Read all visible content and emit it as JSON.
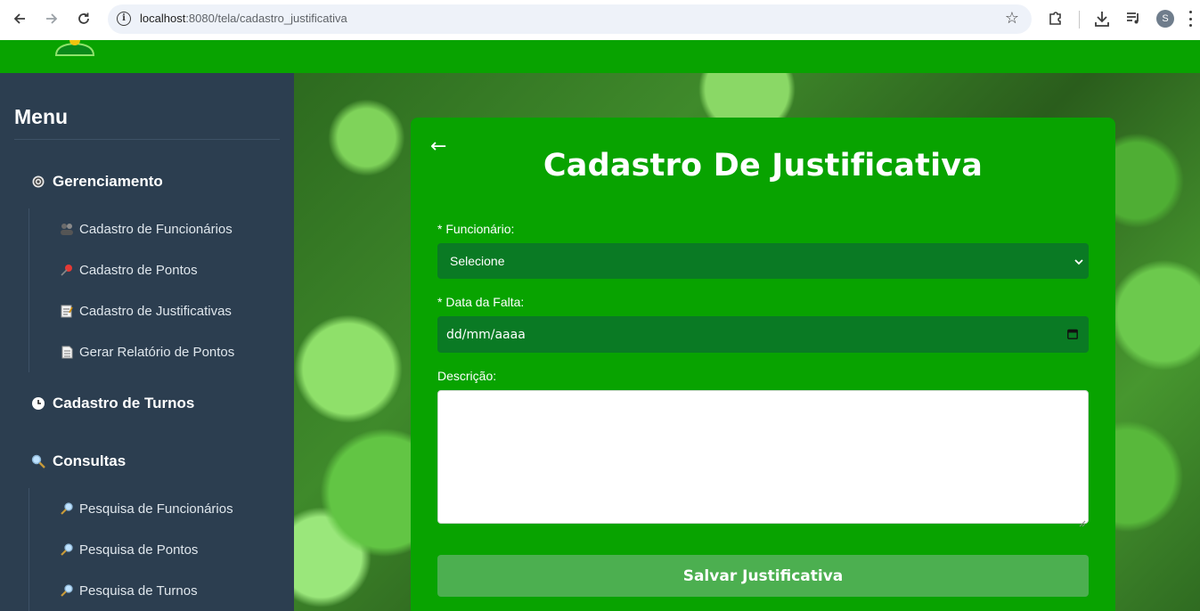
{
  "browser": {
    "url_host": "localhost",
    "url_path": ":8080/tela/cadastro_justificativa",
    "profile_initial": "S"
  },
  "sidebar": {
    "title": "Menu",
    "sections": {
      "gerenciamento": {
        "label": "Gerenciamento",
        "icon": "gear-icon",
        "items": [
          {
            "label": "Cadastro de Funcionários",
            "icon": "people-icon"
          },
          {
            "label": "Cadastro de Pontos",
            "icon": "pushpin-icon"
          },
          {
            "label": "Cadastro de Justificativas",
            "icon": "memo-icon"
          },
          {
            "label": "Gerar Relatório de Pontos",
            "icon": "document-icon"
          }
        ]
      },
      "turnos": {
        "label": "Cadastro de Turnos",
        "icon": "clock-icon"
      },
      "consultas": {
        "label": "Consultas",
        "icon": "magnifier-icon",
        "items": [
          {
            "label": "Pesquisa de Funcionários",
            "icon": "magnifier-right-icon"
          },
          {
            "label": "Pesquisa de Pontos",
            "icon": "magnifier-right-icon"
          },
          {
            "label": "Pesquisa de Turnos",
            "icon": "magnifier-right-icon"
          }
        ]
      }
    }
  },
  "form": {
    "back_symbol": "←",
    "title": "Cadastro De Justificativa",
    "funcionario_label": "* Funcionário:",
    "funcionario_value": "Selecione",
    "data_label": "* Data da Falta:",
    "data_placeholder": "dd/mm/aaaa",
    "descricao_label": "Descrição:",
    "descricao_value": "",
    "save_label": "Salvar Justificativa"
  },
  "colors": {
    "brand_green": "#08a300",
    "input_green": "#0a7a24",
    "button_green": "#4caf50",
    "sidebar_bg": "#2c3e50"
  }
}
